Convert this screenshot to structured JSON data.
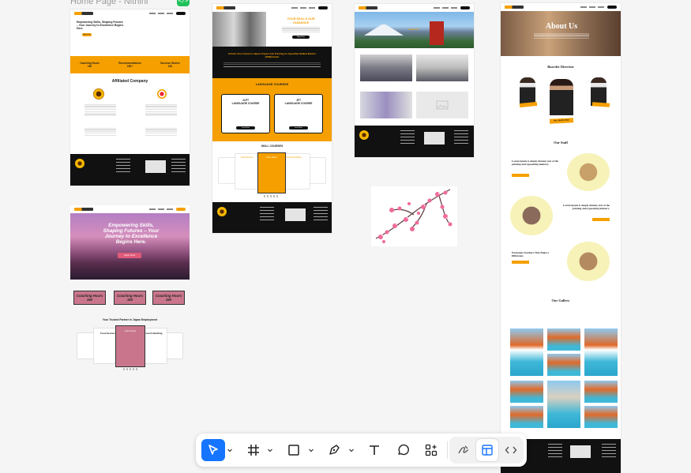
{
  "canvas": {
    "frame_title": "Home Page - Nithini",
    "dev_badge": "</>"
  },
  "frame1": {
    "hero_title": "Empowering Skills, Shaping Futures – Your Journey to Excellence Begins Here.",
    "hero_button": "Apply Now",
    "stats": [
      {
        "label": "Coaching Hours",
        "value": "150"
      },
      {
        "label": "Recommendations",
        "value": "150+"
      },
      {
        "label": "Success Stories",
        "value": "150"
      }
    ],
    "affiliated_title": "Affiliated Company"
  },
  "frame2": {
    "hero_title": "Empowering Skills, Shaping Futures – Your Journey to Excellence Begins Here.",
    "hero_button": "Apply Now",
    "stats": [
      {
        "label": "Coaching Hours",
        "value": "150"
      },
      {
        "label": "Coaching Hours",
        "value": "150"
      },
      {
        "label": "Coaching Hours",
        "value": "150"
      }
    ],
    "partners_title": "Your Trusted Partner in Japan Employment",
    "card_center": "Care Giver",
    "card_left": "Food Service",
    "card_right": "Ground Handling"
  },
  "frame3": {
    "hero_title": "YOUR SKILLS OUR GUIDANCE",
    "hero_button": "Apply Now",
    "banner_title": "Unlock Your Future in Japan: Expert Job Training for Specified Skilled Worker (SSW) Exam",
    "language_title": "LANGUAGE COURSES",
    "course_left": "JLPT\nLANGUAGE COURSE",
    "course_right": "JFT\nLANGUAGE COURSE",
    "course_button": "Learn More",
    "skill_title": "SKILL COURSES",
    "skill_center": "Care Giver",
    "skill_left": "Food Service",
    "skill_right": "Ground Handling"
  },
  "frame4": {
    "hero_title": "About Us"
  },
  "frame6": {
    "hero_title": "About Us",
    "directors_title": "Boarder Directior",
    "director_name": "Mrs. Nimthi Ohar",
    "staff_title": "Our Staff",
    "staff_text_1": "Lorem Ipsum is simply dummy text of the printing and typesetting industry.",
    "staff_text_2": "Lorem Ipsum is simply dummy text of the printing and typesetting industry.",
    "staff_text_3": "Passionate Teachers That Make a Difference",
    "gallery_title": "Our Gallery"
  },
  "toolbar": {
    "tools": [
      "move-tool",
      "frame-tool",
      "shape-tool",
      "pen-tool",
      "text-tool",
      "comment-tool",
      "actions-tool",
      "draw-mode",
      "design-mode",
      "dev-mode"
    ]
  },
  "colors": {
    "accent": "#f5a000",
    "toolbar_active": "#1675ff",
    "dev_badge": "#1fc15a",
    "pink_card": "#c9768c"
  }
}
